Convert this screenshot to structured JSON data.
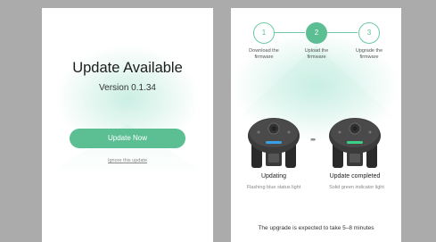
{
  "update_panel": {
    "title": "Update Available",
    "version": "Version 0.1.34",
    "update_button": "Update Now",
    "ignore_link": "Ignore this update"
  },
  "progress_panel": {
    "steps": [
      {
        "number": "1",
        "label_line1": "Download the",
        "label_line2": "firmware",
        "state": "done"
      },
      {
        "number": "2",
        "label_line1": "Upload the",
        "label_line2": "firmware",
        "state": "active"
      },
      {
        "number": "3",
        "label_line1": "Upgrade the",
        "label_line2": "firmware",
        "state": "pending"
      }
    ],
    "devices": [
      {
        "icon": "gimbal-device-icon",
        "status_color": "#3aa0e6",
        "title": "Updating",
        "subtitle": "Flashing blue status light"
      },
      {
        "icon": "gimbal-device-icon",
        "status_color": "#3ccf86",
        "title": "Update completed",
        "subtitle": "Solid green indicator light"
      }
    ],
    "arrow": "›››››",
    "footer": "The upgrade is expected to take 5–8 minutes"
  },
  "colors": {
    "accent": "#5bbf93",
    "background": "#ababab"
  }
}
